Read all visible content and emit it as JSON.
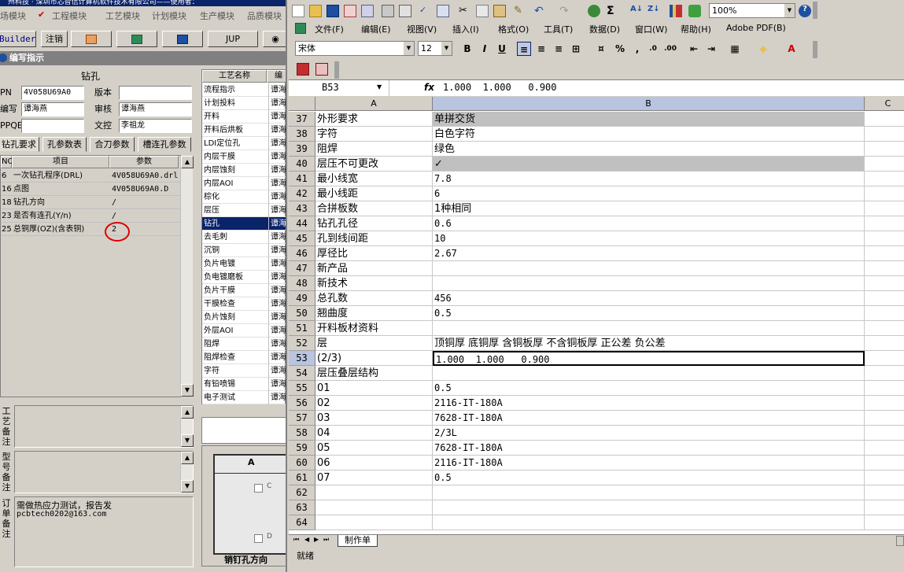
{
  "colors": {
    "accent": "#0a246a",
    "grey_row": "#c0c0c0",
    "highlight": "#d4d0c8"
  },
  "left": {
    "title_text": "州科技 · 深圳市芯智信计算机软件技术有限公司——使用者：",
    "modules": [
      "场模块",
      "工程模块",
      "工艺模块",
      "计划模块",
      "生产模块",
      "品质模块"
    ],
    "toolbar": [
      "Builder",
      "注销",
      "",
      "",
      "",
      "JUP"
    ],
    "panel_title": "编写指示",
    "section_title": "钻孔",
    "fields": {
      "pn_label": "PN",
      "pn_value": "4V058U69A0",
      "version_label": "版本",
      "version_value": "",
      "writer_label": "编写",
      "writer_value": "谭海燕",
      "auditor_label": "审核",
      "auditor_value": "谭海燕",
      "ppqe_label": "PPQE",
      "ppqe_value": "",
      "control_label": "文控",
      "control_value": "李祖龙"
    },
    "tabs": [
      "钻孔要求",
      "孔参数表",
      "合刀参数",
      "槽连孔参数"
    ],
    "grid": {
      "headers": [
        "NO",
        "项目",
        "参数"
      ],
      "rows": [
        [
          "6",
          "一次钻孔程序(DRL)",
          "4V058U69A0.drl"
        ],
        [
          "16",
          "点图",
          "4V058U69A0.D"
        ],
        [
          "18",
          "钻孔方向",
          "/"
        ],
        [
          "23",
          "是否有连孔(Y/n)",
          "/"
        ],
        [
          "25",
          "总铜厚(OZ)(含表铜)",
          "2"
        ]
      ]
    },
    "process": {
      "headers": [
        "工艺名称",
        "编"
      ],
      "rows": [
        "流程指示",
        "计划投料",
        "开料",
        "开料后烘板",
        "LDI定位孔",
        "内层干膜",
        "内层蚀刻",
        "内层AOI",
        "棕化",
        "层压",
        "钻孔",
        "去毛刺",
        "沉铜",
        "负片电镀",
        "负电镀磨板",
        "负片干膜",
        "干膜检查",
        "负片蚀刻",
        "外层AOI",
        "阻焊",
        "阻焊检查",
        "字符",
        "有铅喷锡",
        "电子测试"
      ],
      "editor": "谭海",
      "selected_index": 10
    },
    "notes": {
      "craft_label": "工艺备注",
      "model_label": "型号备注",
      "order_label": "订单备注",
      "order_text_1": "需做热应力测试，报告发",
      "order_text_2": "pcbtech0202@163.com"
    },
    "drawing": {
      "title": "销钉孔方向",
      "col_label": "A",
      "chk1": "C",
      "chk2": "D"
    }
  },
  "excel": {
    "menus": [
      "文件(F)",
      "编辑(E)",
      "视图(V)",
      "插入(I)",
      "格式(O)",
      "工具(T)",
      "数据(D)",
      "窗口(W)",
      "帮助(H)",
      "Adobe PDF(B)"
    ],
    "zoom": "100%",
    "font_name": "宋体",
    "font_size": "12",
    "name_box": "B53",
    "formula": "1.000  1.000   0.900",
    "fx": "fx",
    "columns": [
      "A",
      "B",
      "C"
    ],
    "rows": [
      {
        "n": "37",
        "a": "外形要求",
        "b": "单拼交货",
        "grey": true
      },
      {
        "n": "38",
        "a": "字符",
        "b": "白色字符",
        "grey": false
      },
      {
        "n": "39",
        "a": "阻焊",
        "b": "绿色",
        "grey": false
      },
      {
        "n": "40",
        "a": "层压不可更改",
        "b": "✓",
        "grey": true
      },
      {
        "n": "41",
        "a": "最小线宽",
        "b": "7.8",
        "grey": false
      },
      {
        "n": "42",
        "a": "最小线距",
        "b": "6",
        "grey": false
      },
      {
        "n": "43",
        "a": "合拼板数",
        "b": "1种相同",
        "grey": false
      },
      {
        "n": "44",
        "a": "钻孔孔径",
        "b": "0.6",
        "grey": false
      },
      {
        "n": "45",
        "a": "孔到线间距",
        "b": "10",
        "grey": false
      },
      {
        "n": "46",
        "a": "厚径比",
        "b": "2.67",
        "grey": false
      },
      {
        "n": "47",
        "a": "新产品",
        "b": "",
        "grey": false
      },
      {
        "n": "48",
        "a": "新技术",
        "b": "",
        "grey": false
      },
      {
        "n": "49",
        "a": "总孔数",
        "b": "456",
        "grey": false
      },
      {
        "n": "50",
        "a": "翘曲度",
        "b": "0.5",
        "grey": false
      },
      {
        "n": "51",
        "a": "开料板材资料",
        "b": "",
        "grey": false
      },
      {
        "n": "52",
        "a": "层",
        "b": "顶铜厚 底铜厚 含铜板厚 不含铜板厚 正公差 负公差",
        "grey": false
      },
      {
        "n": "53",
        "a": "(2/3)",
        "b": "1.000  1.000   0.900",
        "grey": false
      },
      {
        "n": "54",
        "a": "层压叠层结构",
        "b": "",
        "grey": false
      },
      {
        "n": "55",
        "a": "01",
        "b": "0.5",
        "grey": false
      },
      {
        "n": "56",
        "a": "02",
        "b": "2116-IT-180A",
        "grey": false
      },
      {
        "n": "57",
        "a": "03",
        "b": "7628-IT-180A",
        "grey": false
      },
      {
        "n": "58",
        "a": "04",
        "b": "2/3L",
        "grey": false
      },
      {
        "n": "59",
        "a": "05",
        "b": "7628-IT-180A",
        "grey": false
      },
      {
        "n": "60",
        "a": "06",
        "b": "2116-IT-180A",
        "grey": false
      },
      {
        "n": "61",
        "a": "07",
        "b": "0.5",
        "grey": false
      },
      {
        "n": "62",
        "a": "",
        "b": "",
        "grey": false
      },
      {
        "n": "63",
        "a": "",
        "b": "",
        "grey": false
      },
      {
        "n": "64",
        "a": "",
        "b": "",
        "grey": false
      }
    ],
    "sheet_tab": "制作单",
    "status": "就绪"
  }
}
